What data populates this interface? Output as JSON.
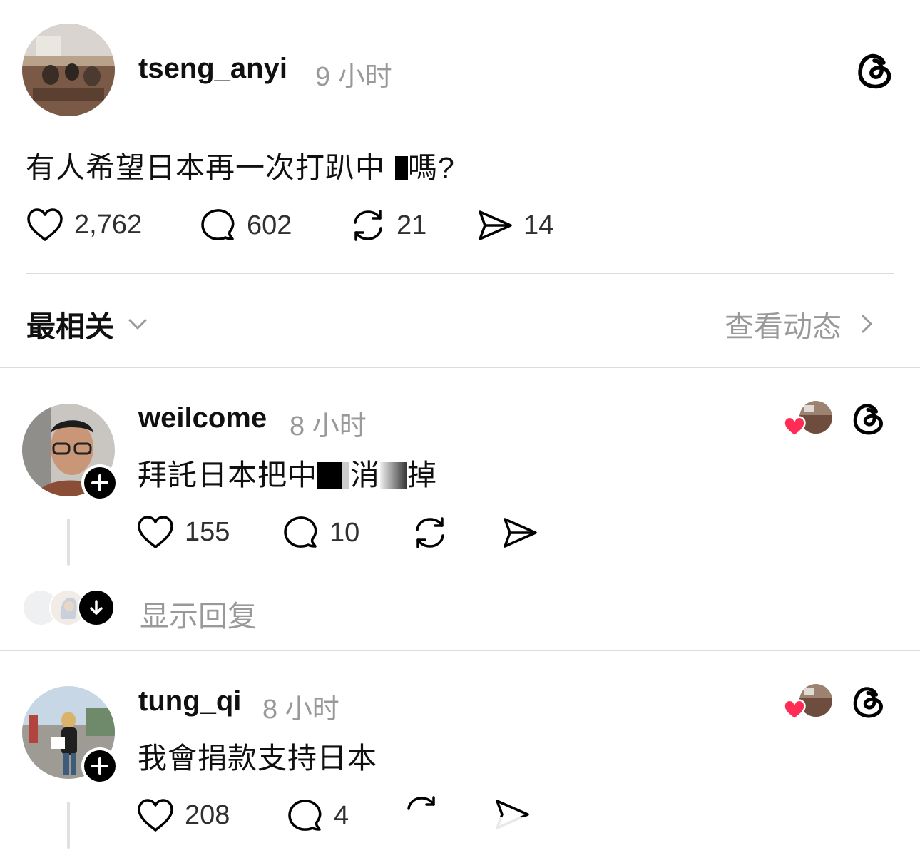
{
  "original_post": {
    "username": "tseng_anyi",
    "time": "9 小时",
    "text_before": "有人希望日本再一次打趴中",
    "text_after": "嗎?",
    "counts": {
      "likes": "2,762",
      "replies": "602",
      "reposts": "21",
      "shares": "14"
    }
  },
  "sort_bar": {
    "sort_label": "最相关",
    "activity_label": "查看动态"
  },
  "replies": [
    {
      "username": "weilcome",
      "time": "8 小时",
      "text_parts": [
        "拜託日本把中",
        "消",
        "掉"
      ],
      "counts": {
        "likes": "155",
        "replies": "10"
      },
      "show_replies_label": "显示回复"
    },
    {
      "username": "tung_qi",
      "time": "8 小时",
      "text": "我會捐款支持日本",
      "counts": {
        "likes": "208",
        "replies": "4"
      }
    }
  ],
  "colors": {
    "heart_red": "#ff2d55",
    "muted_text": "#999999",
    "divider": "#dcdcdc"
  },
  "icons": [
    "threads-logo-icon",
    "heart-icon",
    "comment-icon",
    "repost-icon",
    "share-icon",
    "chevron-down-icon",
    "chevron-right-icon",
    "plus-icon",
    "arrow-down-icon"
  ]
}
